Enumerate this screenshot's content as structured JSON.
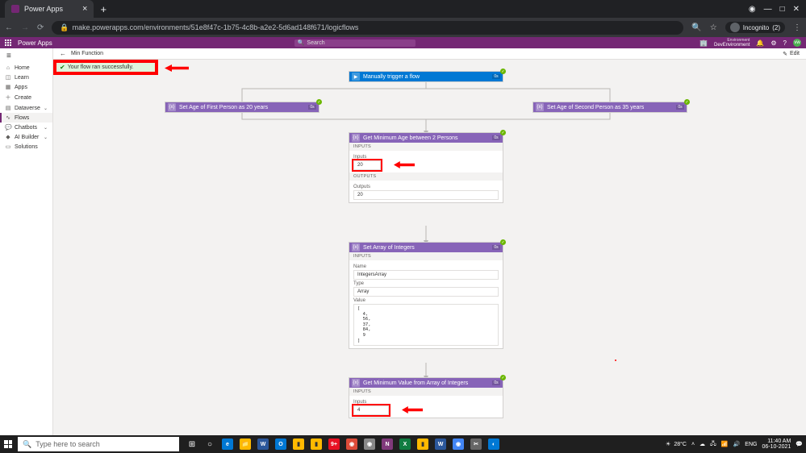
{
  "browser": {
    "tab_title": "Power Apps",
    "url": "make.powerapps.com/environments/51e8f47c-1b75-4c8b-a2e2-5d6ad148f671/logicflows",
    "incognito": {
      "label": "Incognito",
      "count": "(2)"
    }
  },
  "app": {
    "brand": "Power Apps",
    "search_placeholder": "Search",
    "environment_label": "Environment",
    "environment_value": "DevEnvironment",
    "avatar_initials": "vw"
  },
  "nav": {
    "home": "Home",
    "learn": "Learn",
    "apps": "Apps",
    "create": "Create",
    "dataverse": "Dataverse",
    "flows": "Flows",
    "chatbots": "Chatbots",
    "aibuilder": "AI Builder",
    "solutions": "Solutions"
  },
  "crumb": {
    "flow_name": "Min Function",
    "edit": "Edit"
  },
  "banner": {
    "text": "Your flow ran successfully."
  },
  "cards": {
    "trigger": {
      "title": "Manually trigger a flow",
      "ms": "0s"
    },
    "age1": {
      "title": "Set Age of First Person as 20 years",
      "ms": "0s"
    },
    "age2": {
      "title": "Set Age of Second Person as 35 years",
      "ms": "0s"
    },
    "min2": {
      "title": "Get Minimum Age between 2 Persons",
      "ms": "0s",
      "inputs_label": "INPUTS",
      "inputs_field_label": "Inputs",
      "inputs_value": "20",
      "outputs_label": "OUTPUTS",
      "outputs_field_label": "Outputs",
      "outputs_value": "20"
    },
    "setarray": {
      "title": "Set Array of Integers",
      "ms": "0s",
      "inputs_label": "INPUTS",
      "name_label": "Name",
      "name_value": "IntegersArray",
      "type_label": "Type",
      "type_value": "Array",
      "value_label": "Value",
      "value_value": "[\n  4,\n  56,\n  37,\n  84,\n  9\n]"
    },
    "minarr": {
      "title": "Get Minimum Value from Array of Integers",
      "ms": "0s",
      "inputs_label": "INPUTS",
      "inputs_field_label": "Inputs",
      "inputs_value": "4"
    }
  },
  "taskbar": {
    "search_placeholder": "Type here to search",
    "weather_temp": "28°C",
    "lang": "ENG",
    "time": "11:40 AM",
    "date": "06-10-2021"
  }
}
